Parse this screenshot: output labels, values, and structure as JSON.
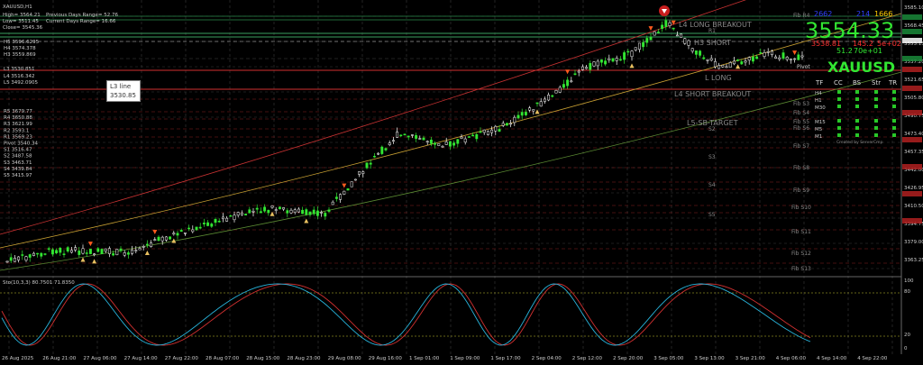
{
  "window": {
    "title": "XAUUSD,H1"
  },
  "info_block": {
    "high": "High= 3564.21",
    "prev_range": "Previous Days Range= 52.76",
    "low": "Low= 3511.45",
    "curr_range": "Current Days Range= 16.66",
    "close": "Close= 3545.36"
  },
  "pivot_levels_top": [
    "H5 3596.6295",
    "H4 3574.378",
    "H3 3559.869",
    "L3 3530.851",
    "L4 3516.342",
    "L5 3492.0905"
  ],
  "pivot_levels_mid": [
    "R5 3679.77",
    "R4 3650.88",
    "R3 3621.99",
    "R2 3593.1",
    "R1 3569.23",
    "Pivot 3540.34",
    "S1 3516.47",
    "S2 3487.58",
    "S3 3463.71",
    "S4 3439.84",
    "S5 3415.97"
  ],
  "tooltip": {
    "line1": "L3 line",
    "line2": "3530.85"
  },
  "price_big": "3554.33",
  "price_small_a": "2662",
  "price_small_b": "214",
  "price_small_c": "1666",
  "symbol": "XAUUSD",
  "red_readout": "3538.81",
  "red_readout2": "145.2",
  "red_readout3": "5e+02",
  "green_readout": "51.2",
  "green_readout2": "70e+01",
  "chart_labels": {
    "fib_r4": "Fib R4",
    "r1": "R1",
    "long_breakout": "L4 LONG BREAKOUT",
    "h3_short": "H3 SHORT",
    "pivot": "Pivot",
    "long": "L LONG",
    "short_breakout": "L4 SHORT BREAKOUT",
    "l5_target": "L5-SB-TARGET",
    "s2": "S2",
    "s3": "S3",
    "s4": "S4",
    "s5": "S5",
    "fib_s3": "Fib S3",
    "fib_s4": "Fib S4",
    "fib_s5": "Fib S5",
    "fib_s6": "Fib S6",
    "fib_s7": "Fib S7",
    "fib_s8": "Fib S8",
    "fib_s9": "Fib S9",
    "fib_s10": "Fib S10",
    "fib_s11": "Fib S11",
    "fib_s12": "Fib S12",
    "fib_s13": "Fib S13"
  },
  "strength_table": {
    "headers": [
      "TF",
      "CC",
      "BS",
      "Str",
      "TR"
    ],
    "rows": [
      "H4",
      "H1",
      "M30",
      "M15",
      "M5",
      "M1"
    ],
    "footer": "Created by ServerCmp"
  },
  "price_axis": [
    "3585.10",
    "3568.45",
    "3553.15",
    "3537.20",
    "3521.65",
    "3505.80",
    "3490.75",
    "3473.40",
    "3457.35",
    "3442.00",
    "3426.95",
    "3410.50",
    "3394.75",
    "3379.00",
    "3363.25"
  ],
  "time_axis": [
    "26 Aug 2025",
    "26 Aug 21:00",
    "27 Aug 06:00",
    "27 Aug 14:00",
    "27 Aug 22:00",
    "28 Aug 07:00",
    "28 Aug 15:00",
    "28 Aug 23:00",
    "29 Aug 08:00",
    "29 Aug 16:00",
    "1 Sep 01:00",
    "1 Sep 09:00",
    "1 Sep 17:00",
    "2 Sep 04:00",
    "2 Sep 12:00",
    "2 Sep 20:00",
    "3 Sep 05:00",
    "3 Sep 13:00",
    "3 Sep 21:00",
    "4 Sep 06:00",
    "4 Sep 14:00",
    "4 Sep 22:00"
  ],
  "stoch": {
    "label": "Sto(10,3,3) 80.7501 71.8350",
    "levels": [
      "100",
      "80",
      "20",
      "0"
    ]
  },
  "colors": {
    "bull": "#32e632",
    "bear": "#ffffff",
    "res": "#c83232",
    "sup": "#5a8a32",
    "accent": "#ffcc00"
  }
}
